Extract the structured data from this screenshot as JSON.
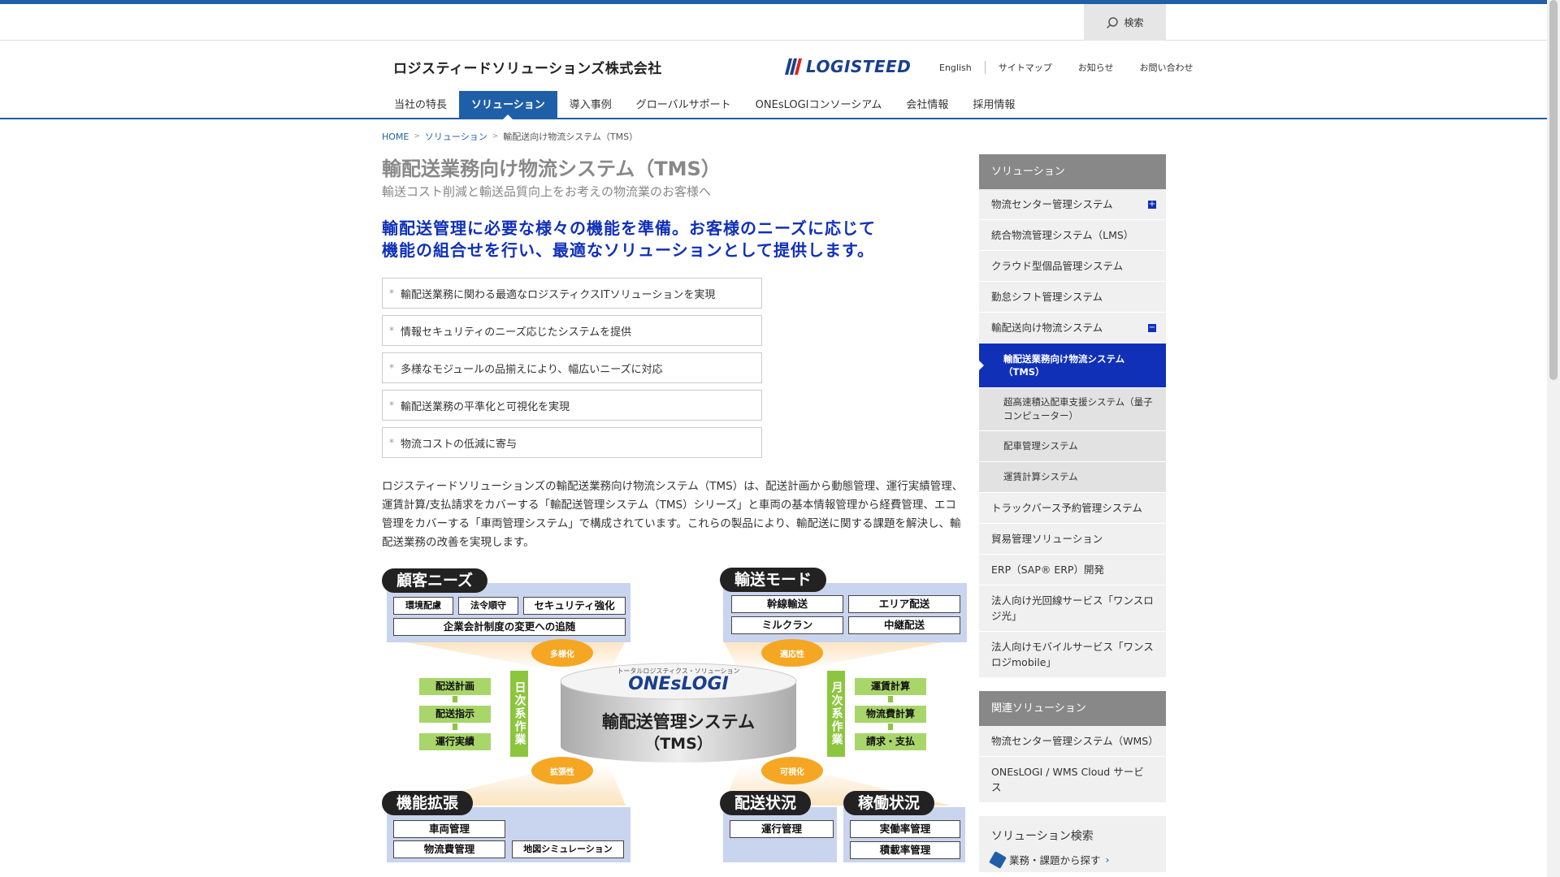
{
  "header": {
    "search_label": "検索",
    "company": "ロジスティードソリューションズ株式会社",
    "logo": "LOGISTEED",
    "util_links": [
      "English",
      "サイトマップ",
      "お知らせ",
      "お問い合わせ"
    ],
    "nav": [
      "当社の特長",
      "ソリューション",
      "導入事例",
      "グローバルサポート",
      "ONEsLOGIコンソーシアム",
      "会社情報",
      "採用情報"
    ],
    "active_nav": 1
  },
  "breadcrumb": [
    "HOME",
    "ソリューション",
    "輸配送向け物流システム（TMS）"
  ],
  "main": {
    "title": "輸配送業務向け物流システム（TMS）",
    "subtitle": "輸送コスト削減と輸送品質向上をお考えの物流業のお客様へ",
    "lead_1": "輸配送管理に必要な様々の機能を準備。お客様のニーズに応じて",
    "lead_2": "機能の組合せを行い、最適なソリューションとして提供します。",
    "points": [
      "輸配送業務に関わる最適なロジスティクスITソリューションを実現",
      "情報セキュリティのニーズ応じたシステムを提供",
      "多様なモジュールの品揃えにより、幅広いニーズに対応",
      "輸配送業務の平準化と可視化を実現",
      "物流コストの低減に寄与"
    ],
    "description": "ロジスティードソリューションズの輸配送業務向け物流システム（TMS）は、配送計画から動態管理、運行実績管理、運賃計算/支払請求をカバーする「輸配送管理システム（TMS）シリーズ」と車両の基本情報管理から経費管理、エコ管理をカバーする「車両管理システム」で構成されています。これらの製品により、輸配送に関する課題を解決し、輸配送業務の改善を実現します。"
  },
  "diagram": {
    "customer_needs": "顧客ニーズ",
    "needs_items": [
      "環境配慮",
      "法令順守",
      "セキュリティ強化",
      "企業会計制度の変更への追随"
    ],
    "transport_mode": "輸送モード",
    "mode_items": [
      "幹線輸送",
      "エリア配送",
      "ミルクラン",
      "中継配送"
    ],
    "oval_top_left": "多様化",
    "oval_top_right": "適応性",
    "oval_bottom_left": "拡張性",
    "oval_bottom_right": "可視化",
    "daily_items": [
      "配送計画",
      "配送指示",
      "運行実績"
    ],
    "daily_label": "日次系作業",
    "monthly_items": [
      "運賃計算",
      "物流費計算",
      "請求・支払"
    ],
    "monthly_label": "月次系作業",
    "center_tagline": "トータルロジスティクス・ソリューション",
    "center_brand": "ONEsLOGI",
    "center_title": "輸配送管理システム",
    "center_sub": "（TMS）",
    "expansion": "機能拡張",
    "expansion_items": [
      "車両管理",
      "物流費管理",
      "地図シミュレーション"
    ],
    "delivery_status": "配送状況",
    "delivery_items": [
      "運行管理"
    ],
    "operation_status": "稼働状況",
    "operation_items": [
      "実働率管理",
      "積載率管理"
    ]
  },
  "sidebar": {
    "head": "ソリューション",
    "items": [
      {
        "label": "物流センター管理システム",
        "mark": "+"
      },
      {
        "label": "統合物流管理システム（LMS）"
      },
      {
        "label": "クラウド型個品管理システム"
      },
      {
        "label": "勤怠シフト管理システム"
      },
      {
        "label": "輸配送向け物流システム",
        "mark": "−"
      }
    ],
    "current": "輸配送業務向け物流システム（TMS）",
    "sub_items": [
      "超高速積込配車支援システム（量子コンピューター）",
      "配車管理システム",
      "運賃計算システム"
    ],
    "items_after": [
      "トラックバース予約管理システム",
      "貿易管理ソリューション",
      "ERP（SAP® ERP）開発",
      "法人向け光回線サービス「ワンスロジ光」",
      "法人向けモバイルサービス「ワンスロジmobile」"
    ],
    "related_head": "関連ソリューション",
    "related_items": [
      "物流センター管理システム（WMS）",
      "ONEsLOGI / WMS Cloud サービス"
    ],
    "search_title": "ソリューション検索",
    "search_link": "業務・課題から探す"
  },
  "colors": {
    "brand": "#1f5fa8",
    "lead": "#1030b8",
    "green": "#8cc63f",
    "orange": "#f5a623"
  }
}
